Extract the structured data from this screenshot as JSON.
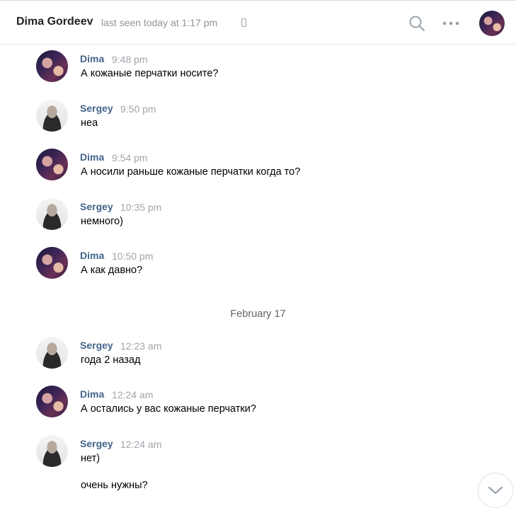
{
  "header": {
    "name": "Dima Gordeev",
    "status": "last seen today at 1:17 pm"
  },
  "messages": [
    {
      "author": "Dima",
      "time": "9:48 pm",
      "text": "А кожаные перчатки носите?"
    },
    {
      "author": "Sergey",
      "time": "9:50 pm",
      "text": "неа"
    },
    {
      "author": "Dima",
      "time": "9:54 pm",
      "text": "А носили раньше кожаные перчатки когда то?"
    },
    {
      "author": "Sergey",
      "time": "10:35 pm",
      "text": "немного)"
    },
    {
      "author": "Dima",
      "time": "10:50 pm",
      "text": "А как давно?"
    },
    {
      "author": "Sergey",
      "time": "12:23 am",
      "text": "года 2 назад"
    },
    {
      "author": "Dima",
      "time": "12:24 am",
      "text": "А остались у вас кожаные перчатки?"
    },
    {
      "author": "Sergey",
      "time": "12:24 am",
      "text": "нет)",
      "text2": "очень нужны?"
    }
  ],
  "date_separator": "February 17",
  "icons": {
    "search": "search-icon",
    "more": "more-icon",
    "phone": "mobile-phone-icon",
    "scroll_down": "chevron-down-icon"
  },
  "colors": {
    "author": "#42648b",
    "muted": "#a0a5ab",
    "text": "#000000"
  }
}
